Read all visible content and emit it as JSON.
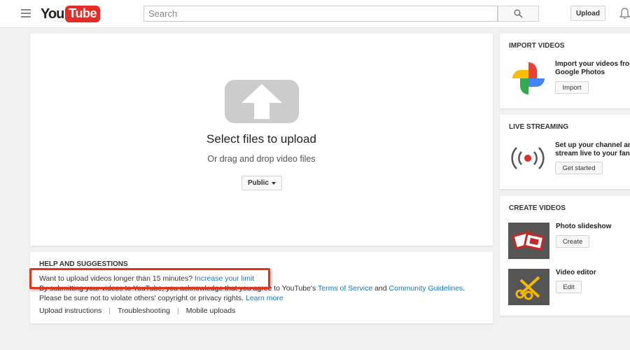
{
  "header": {
    "logo_you": "You",
    "logo_tube": "Tube",
    "search_placeholder": "Search",
    "upload_label": "Upload"
  },
  "upload": {
    "title": "Select files to upload",
    "subtitle": "Or drag and drop video files",
    "privacy_label": "Public"
  },
  "help": {
    "heading": "HELP AND SUGGESTIONS",
    "long_videos_text": "Want to upload videos longer than 15 minutes?",
    "increase_limit_link": "Increase your limit",
    "terms_prefix": "By submitting your videos to YouTube, you acknowledge that you agree to YouTube's",
    "terms_link": "Terms of Service",
    "and_text": "and",
    "guidelines_link": "Community Guidelines",
    "rights_text": "Please be sure not to violate others' copyright or privacy rights.",
    "learn_more_link": "Learn more",
    "links": [
      "Upload instructions",
      "Troubleshooting",
      "Mobile uploads"
    ]
  },
  "sidebar": {
    "import": {
      "heading": "IMPORT VIDEOS",
      "text_line1": "Import your videos fron",
      "text_line2": "Google Photos",
      "button": "Import"
    },
    "live": {
      "heading": "LIVE STREAMING",
      "text_line1": "Set up your channel an",
      "text_line2": "stream live to your fans",
      "button": "Get started"
    },
    "create": {
      "heading": "CREATE VIDEOS",
      "slideshow_label": "Photo slideshow",
      "slideshow_button": "Create",
      "editor_label": "Video editor",
      "editor_button": "Edit"
    }
  },
  "colors": {
    "brand_red": "#e52d27",
    "link_blue": "#167ac6",
    "highlight_red": "#e0341c"
  }
}
